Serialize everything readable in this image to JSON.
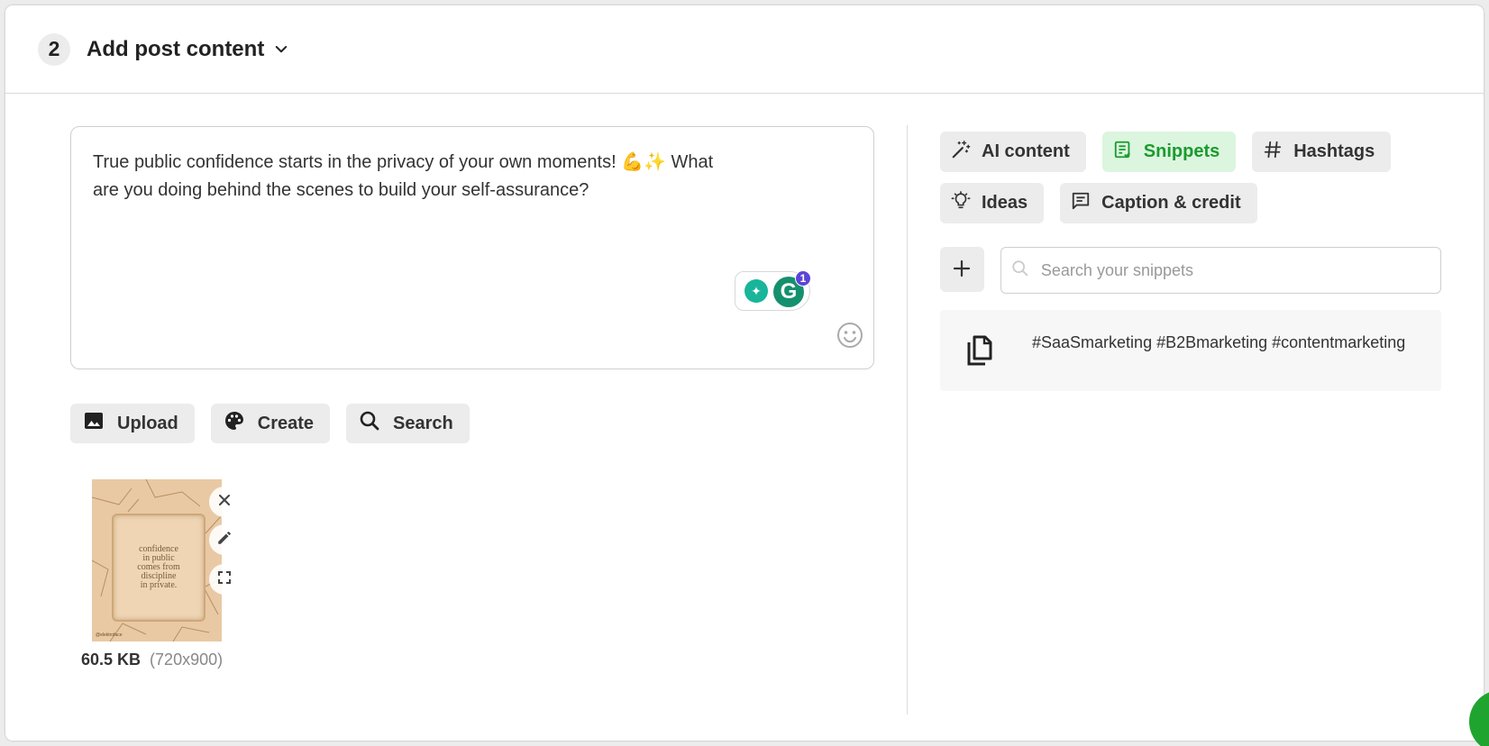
{
  "header": {
    "step": "2",
    "title": "Add post content"
  },
  "editor": {
    "text_line1": "True public confidence starts in the privacy of your own moments! 💪✨ What",
    "text_line2": "are you doing behind the scenes to build your self-assurance?",
    "grammarly_count": "1",
    "grammarly_letter": "G"
  },
  "media": {
    "upload_label": "Upload",
    "create_label": "Create",
    "search_label": "Search"
  },
  "attachment": {
    "image_text": [
      "confidence",
      "in public",
      "comes from",
      "discipline",
      "in private."
    ],
    "watermark": "@elektroface",
    "size": "60.5 KB",
    "dimensions": "(720x900)"
  },
  "tabs": [
    {
      "label": "AI content",
      "icon": "magic-wand-icon"
    },
    {
      "label": "Snippets",
      "icon": "snippet-icon",
      "active": true
    },
    {
      "label": "Hashtags",
      "icon": "hash-icon"
    },
    {
      "label": "Ideas",
      "icon": "lightbulb-icon"
    },
    {
      "label": "Caption & credit",
      "icon": "comment-icon"
    }
  ],
  "snippets": {
    "search_placeholder": "Search your snippets",
    "items": [
      {
        "text": "#SaaSmarketing #B2Bmarketing #contentmarketing"
      }
    ]
  },
  "colors": {
    "accent_green": "#1a9b2e",
    "active_tab_bg": "#dcf5df",
    "button_bg": "#ececec",
    "grammarly_green": "#15906f",
    "grammarly_badge": "#5b44d6"
  }
}
